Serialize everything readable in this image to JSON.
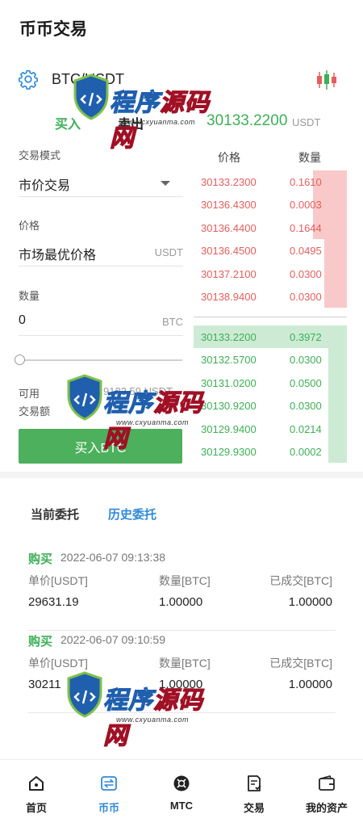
{
  "header": {
    "title": "币币交易"
  },
  "pair": {
    "name": "BTC/USDT",
    "settings_icon": "gear-icon",
    "chart_icon": "candlestick-icon"
  },
  "trade_tabs": {
    "buy": "买入",
    "sell": "卖出"
  },
  "last_price": {
    "value": "30133.2200",
    "unit": "USDT"
  },
  "form": {
    "mode_label": "交易模式",
    "mode_value": "市价交易",
    "price_label": "价格",
    "price_value": "市场最优价格",
    "price_unit": "USDT",
    "qty_label": "数量",
    "qty_value": "0",
    "qty_unit": "BTC",
    "slider_percent": 0,
    "available_label": "可用",
    "available_value": "9133.59 USDT",
    "trade_amount_label": "交易额",
    "submit_label": "买入BTC"
  },
  "orderbook": {
    "price_header": "价格",
    "qty_header": "数量",
    "asks": [
      {
        "price": "30133.2300",
        "qty": "0.1610",
        "depth": 0.22
      },
      {
        "price": "30136.4300",
        "qty": "0.0003",
        "depth": 0.22
      },
      {
        "price": "30136.4400",
        "qty": "0.1644",
        "depth": 0.22
      },
      {
        "price": "30136.4500",
        "qty": "0.0495",
        "depth": 0.15
      },
      {
        "price": "30137.2100",
        "qty": "0.0300",
        "depth": 0.15
      },
      {
        "price": "30138.9400",
        "qty": "0.0300",
        "depth": 0.15
      }
    ],
    "bids": [
      {
        "price": "30133.2200",
        "qty": "0.3972",
        "depth": 1.0
      },
      {
        "price": "30132.5700",
        "qty": "0.0300",
        "depth": 0.12
      },
      {
        "price": "30131.0200",
        "qty": "0.0500",
        "depth": 0.12
      },
      {
        "price": "30130.9200",
        "qty": "0.0300",
        "depth": 0.12
      },
      {
        "price": "30129.9400",
        "qty": "0.0214",
        "depth": 0.12
      },
      {
        "price": "30129.9300",
        "qty": "0.0002",
        "depth": 0.12
      }
    ]
  },
  "orders_tabs": {
    "current": "当前委托",
    "history": "历史委托"
  },
  "orders": [
    {
      "side": "购买",
      "time": "2022-06-07 09:13:38",
      "h1": "单价[USDT]",
      "h2": "数量[BTC]",
      "h3": "已成交[BTC]",
      "price": "29631.19",
      "qty": "1.00000",
      "filled": "1.00000"
    },
    {
      "side": "购买",
      "time": "2022-06-07 09:10:59",
      "h1": "单价[USDT]",
      "h2": "数量[BTC]",
      "h3": "已成交[BTC]",
      "price": "30211",
      "qty": "1.00000",
      "filled": "1.00000"
    }
  ],
  "nav": [
    {
      "label": "首页",
      "icon": "home-icon"
    },
    {
      "label": "币币",
      "icon": "exchange-icon",
      "active": true
    },
    {
      "label": "MTC",
      "icon": "mtc-icon"
    },
    {
      "label": "交易",
      "icon": "trade-doc-icon"
    },
    {
      "label": "我的资产",
      "icon": "wallet-icon"
    }
  ],
  "watermark": {
    "text": "程序源码网",
    "url": "www.cxyuanma.com"
  },
  "colors": {
    "green": "#4cb05c",
    "red": "#e55d5d",
    "blue": "#2f8ad8"
  }
}
